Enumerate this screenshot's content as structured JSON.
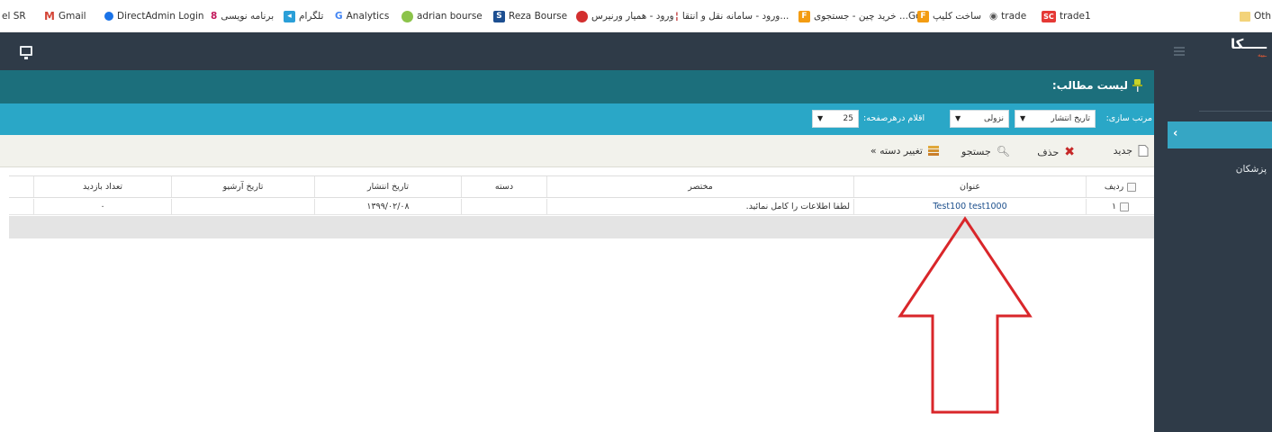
{
  "bookmarks": [
    {
      "label": "el SR",
      "icon": "none"
    },
    {
      "label": "Gmail",
      "icon": "gmail-icon"
    },
    {
      "label": "DirectAdmin Login",
      "icon": "circle-icon"
    },
    {
      "label": "برنامه نویسی",
      "icon": "logo-icon"
    },
    {
      "label": "تلگرام",
      "icon": "telegram-icon"
    },
    {
      "label": "Analytics",
      "icon": "google-icon"
    },
    {
      "label": "adrian bourse",
      "icon": "target-icon"
    },
    {
      "label": "Reza Bourse",
      "icon": "logo-icon"
    },
    {
      "label": "ورود - همیار ورنیرس",
      "icon": "logo-icon"
    },
    {
      "label": "ورود - سامانه نقل و انتقا...",
      "icon": "logo-icon"
    },
    {
      "label": "خرید چین - جستجوی ...Go",
      "icon": "logo-icon"
    },
    {
      "label": "ساخت کلیپ",
      "icon": "logo-icon"
    },
    {
      "label": "trade",
      "icon": "globe-icon"
    },
    {
      "label": "trade1",
      "icon": "sc-icon"
    },
    {
      "label": "Oth",
      "icon": "folder-icon"
    }
  ],
  "brand": {
    "name": "ـــــكا",
    "sub": "ـبیه"
  },
  "sidebar": {
    "item_label": "پزشکان",
    "active_chevron": "‹"
  },
  "page": {
    "title": "لیست مطالب:"
  },
  "filters": {
    "sort_label": "مرتب سازی:",
    "sort_field": "تاریخ انتشار",
    "sort_order": "نزولی",
    "per_page_label": "اقلام درهرصفحه:",
    "per_page_value": "25"
  },
  "toolbar": {
    "new_label": "جدید",
    "delete_label": "حذف",
    "search_label": "جستجو",
    "change_category_label": "تغییر دسته »"
  },
  "table": {
    "headers": {
      "row": "ردیف",
      "title": "عنوان",
      "summary": "مختصر",
      "category": "دسته",
      "publish_date": "تاریخ انتشار",
      "archive_date": "تاریخ آرشیو",
      "visit_count": "تعداد بازدید"
    },
    "rows": [
      {
        "row": "۱",
        "title": "Test100 test1000",
        "summary": "لطفا اطلاعات را کامل نمائید.",
        "category": "",
        "publish_date": "۱۳۹۹/۰۲/۰۸",
        "archive_date": "",
        "visit_count": "۰"
      }
    ]
  },
  "colors": {
    "topbar": "#2f3b48",
    "titlebar": "#1c6f7c",
    "filterbar": "#2aa7c7",
    "sidebar_active": "#36a6c4",
    "arrow": "#d9262a"
  }
}
